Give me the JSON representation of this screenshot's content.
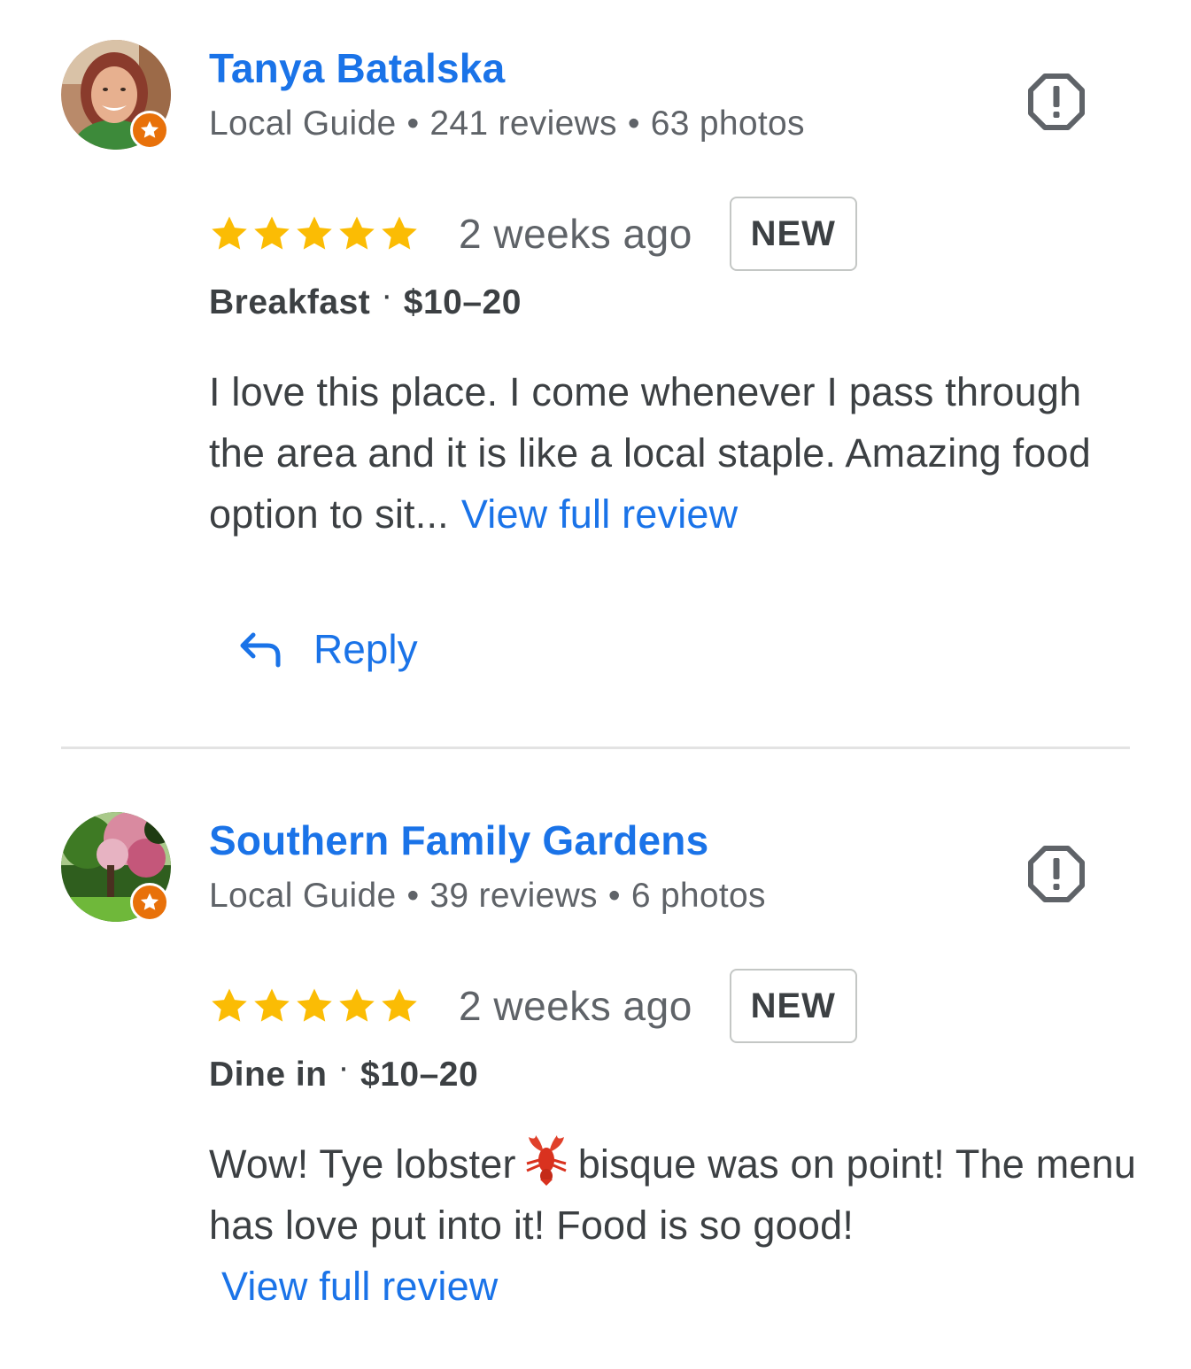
{
  "colors": {
    "accent_blue": "#1a73e8",
    "star_yellow": "#fbbc04",
    "local_guide_badge": "#e8710a",
    "text_primary": "#3c4043",
    "text_secondary": "#5f6368",
    "divider": "#e3e3e3"
  },
  "icons": {
    "flag": "flag-review-icon",
    "star": "star-icon",
    "reply": "reply-arrow-icon",
    "badge": "local-guide-star-icon",
    "emoji": "lobster-emoji"
  },
  "reviews": [
    {
      "author": "Tanya Batalska",
      "guide_label": "Local Guide",
      "meta_dot": "•",
      "reviews_count": "241 reviews",
      "photos_count": "63 photos",
      "rating": 5,
      "time_ago": "2 weeks ago",
      "badge": "NEW",
      "meal_type": "Breakfast",
      "meal_dot": "·",
      "price": "$10–20",
      "text": "I love this place. I come whenever I pass through the area and it is like a local staple. Amazing food option to sit...",
      "view_full": "View full review",
      "reply_label": "Reply"
    },
    {
      "author": "Southern Family Gardens",
      "guide_label": "Local Guide",
      "meta_dot": "•",
      "reviews_count": "39 reviews",
      "photos_count": "6 photos",
      "rating": 5,
      "time_ago": "2 weeks ago",
      "badge": "NEW",
      "meal_type": "Dine in",
      "meal_dot": "·",
      "price": "$10–20",
      "text_before_emoji": "Wow! Tye lobster",
      "text_after_emoji": "bisque was on point! The menu has love put into it! Food is so good!",
      "view_full": "View full review"
    }
  ]
}
